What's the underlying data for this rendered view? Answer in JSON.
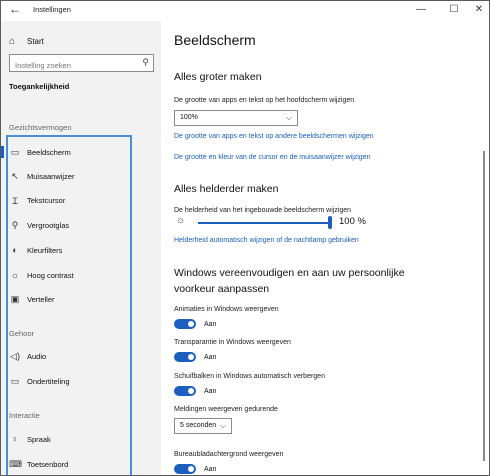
{
  "window": {
    "title": "Instellingen",
    "back_icon": "←",
    "minimize_icon": "—",
    "maximize_icon": "☐",
    "close_icon": "✕"
  },
  "sidebar": {
    "home_label": "Start",
    "home_icon": "⌂",
    "search_placeholder": "Instelling zoeken",
    "search_icon": "⚲",
    "section_title": "Toegankelijkheid",
    "groups": [
      {
        "label": "Gezichtsvermogen",
        "items": [
          {
            "label": "Beeldscherm",
            "icon": "▭"
          },
          {
            "label": "Muisaanwijzer",
            "icon": "↖"
          },
          {
            "label": "Tekstcursor",
            "icon": "Ɪ"
          },
          {
            "label": "Vergrootglas",
            "icon": "⚲"
          },
          {
            "label": "Kleurfilters",
            "icon": "◐"
          },
          {
            "label": "Hoog contrast",
            "icon": "☼"
          },
          {
            "label": "Verteller",
            "icon": "▣"
          }
        ]
      },
      {
        "label": "Gehoor",
        "items": [
          {
            "label": "Audio",
            "icon": "◁)"
          },
          {
            "label": "Ondertiteling",
            "icon": "▭"
          }
        ]
      },
      {
        "label": "Interactie",
        "items": [
          {
            "label": "Spraak",
            "icon": "♀"
          },
          {
            "label": "Toetsenbord",
            "icon": "⌨"
          }
        ]
      }
    ]
  },
  "content": {
    "page_title": "Beeldscherm",
    "section1": {
      "title": "Alles groter maken",
      "label": "De grootte van apps en tekst op het hoofdscherm wijzigen",
      "dropdown_value": "100%",
      "chevron_icon": "⌵",
      "link1": "De grootte van apps en tekst op andere beeldschermen wijzigen",
      "link2": "De grootte en kleur van de cursor en de muisaanwijzer wijzigen"
    },
    "section2": {
      "title": "Alles helderder maken",
      "label": "De helderheid van het ingebouwde beeldscherm wijzigen",
      "sun_icon": "☼",
      "brightness_value": "100 %",
      "brightness_fraction": 1.0,
      "link": "Helderheid automatisch wijzigen of de nachtlamp gebruiken"
    },
    "section3": {
      "title_line1": "Windows vereenvoudigen en aan uw persoonlijke",
      "title_line2": "voorkeur aanpassen",
      "toggles": [
        {
          "label": "Animaties in Windows weergeven",
          "state": "Aan"
        },
        {
          "label": "Transparantie in Windows weergeven",
          "state": "Aan"
        },
        {
          "label": "Schuifbalken in Windows automatisch verbergen",
          "state": "Aan"
        }
      ],
      "notif_label": "Meldingen weergeven gedurende",
      "notif_value": "5 seconden",
      "desktop_bg_label": "Bureaubladachtergrond weergeven",
      "desktop_bg_state": "Aan"
    }
  },
  "colors": {
    "accent": "#1d5fc0",
    "link": "#1a5fb4",
    "highlight_box": "#4a90d9",
    "sidebar_bg": "#f2f2f2"
  }
}
